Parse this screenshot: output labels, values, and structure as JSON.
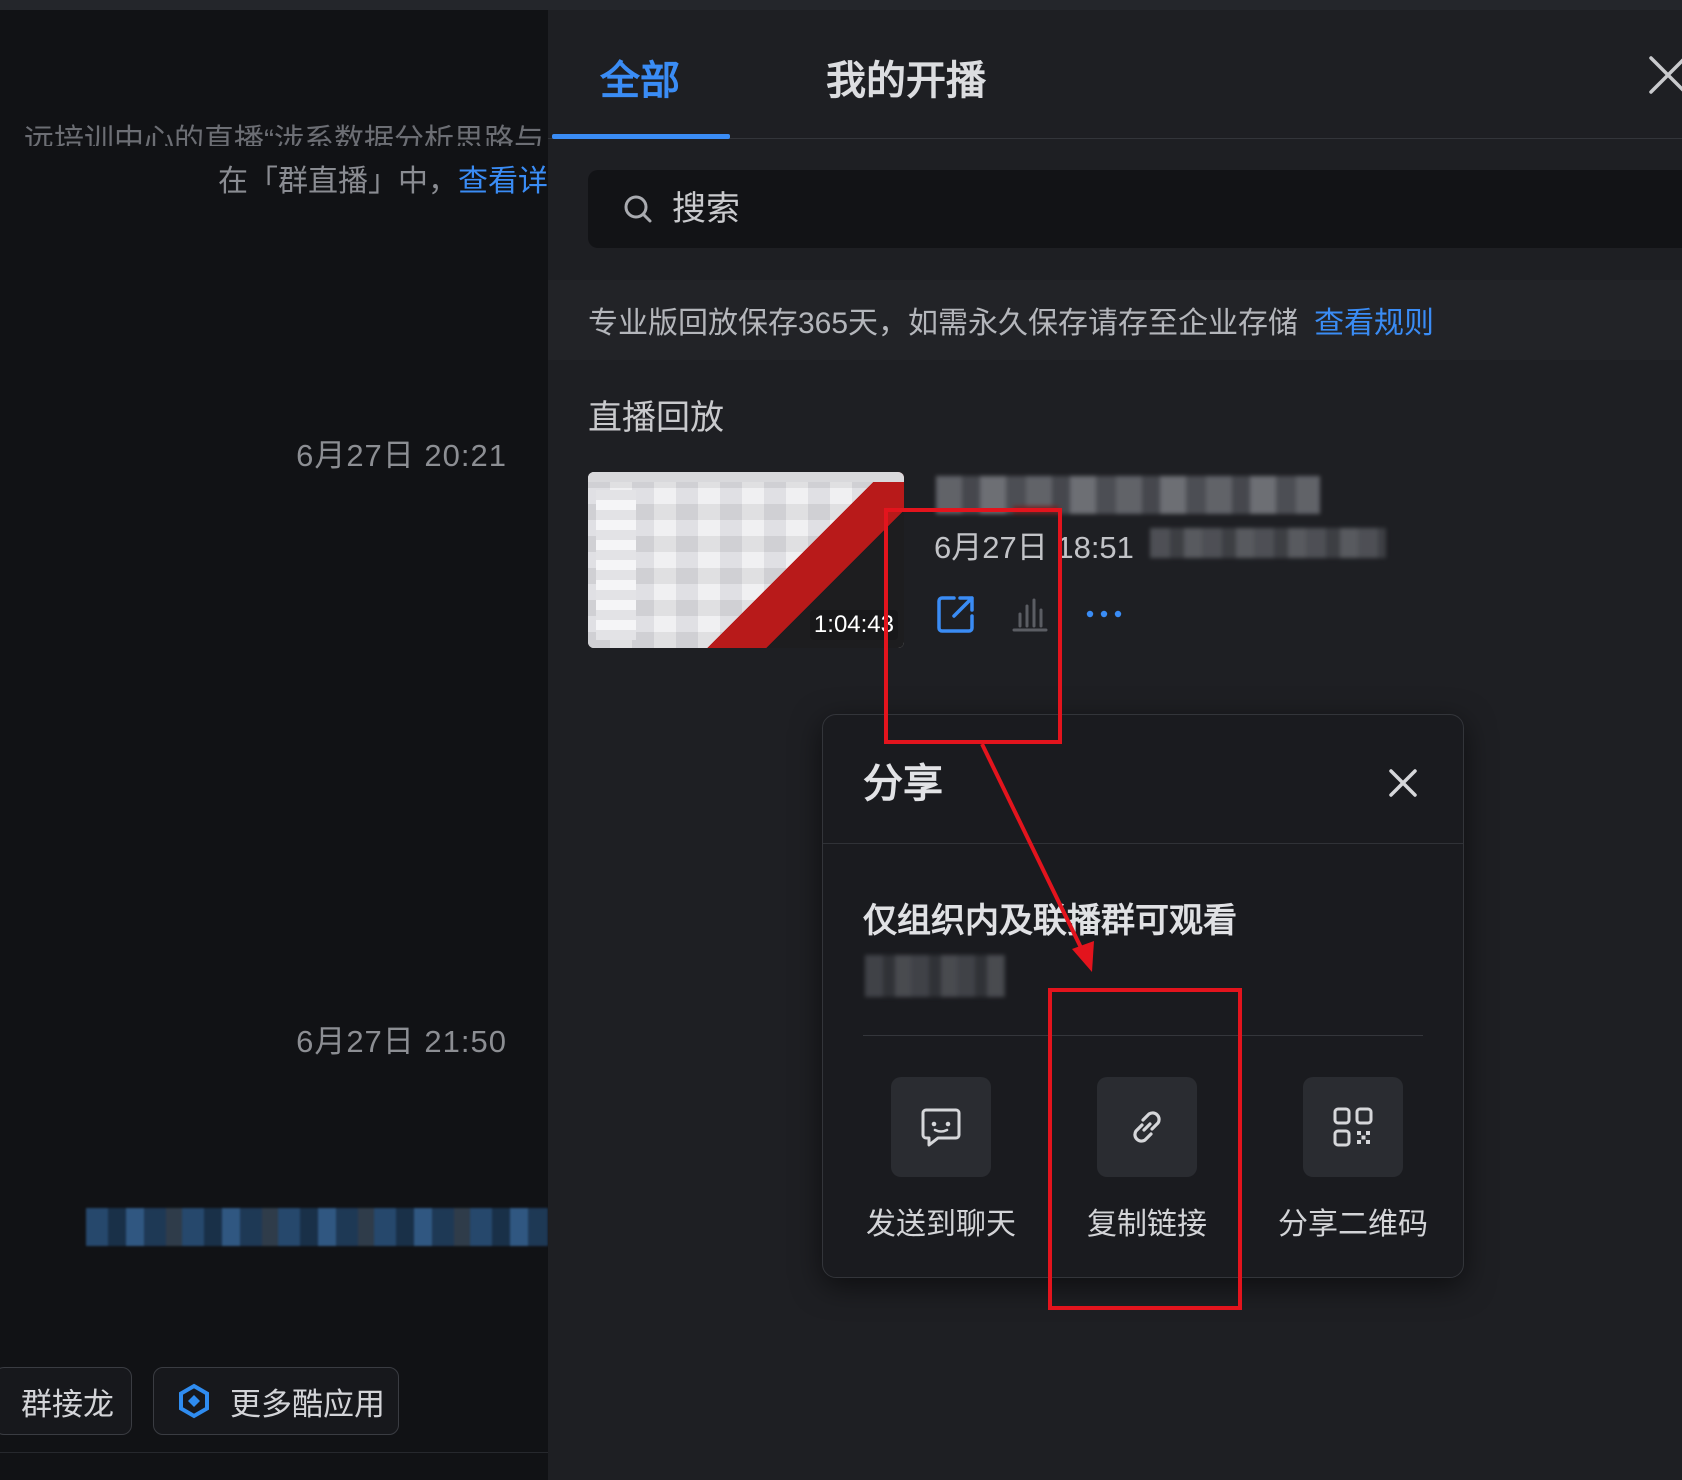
{
  "chat": {
    "clipped_line": "远培训中心的直播“涉系数据分析思路与",
    "notice_prefix": "在「群直播」中，",
    "notice_link": "查看详",
    "timestamps": [
      "6月27日 20:21",
      "6月27日 21:50"
    ],
    "bottom_buttons": [
      {
        "label": "群接龙"
      },
      {
        "label": "更多酷应用",
        "icon": "cool-app-icon"
      }
    ]
  },
  "panel": {
    "tabs": [
      {
        "label": "全部",
        "active": true
      },
      {
        "label": "我的开播",
        "active": false
      }
    ],
    "close_icon": "close-icon",
    "search": {
      "placeholder": "搜索",
      "icon": "search-icon"
    },
    "info": {
      "text": "专业版回放保存365天，如需永久保存请存至企业存储",
      "link": "查看规则"
    },
    "section_title": "直播回放",
    "recording": {
      "duration": "1:04:43",
      "time": "6月27日 18:51",
      "actions": [
        "share-icon",
        "stats-icon",
        "more-icon"
      ]
    }
  },
  "share_popup": {
    "title": "分享",
    "scope": "仅组织内及联播群可观看",
    "options": [
      {
        "label": "发送到聊天",
        "icon": "chat-icon"
      },
      {
        "label": "复制链接",
        "icon": "link-icon"
      },
      {
        "label": "分享二维码",
        "icon": "qrcode-icon"
      }
    ]
  },
  "colors": {
    "accent": "#3a8cf5",
    "highlight": "#e3141d",
    "panel_bg": "#1e1f23",
    "chat_bg": "#111215"
  }
}
